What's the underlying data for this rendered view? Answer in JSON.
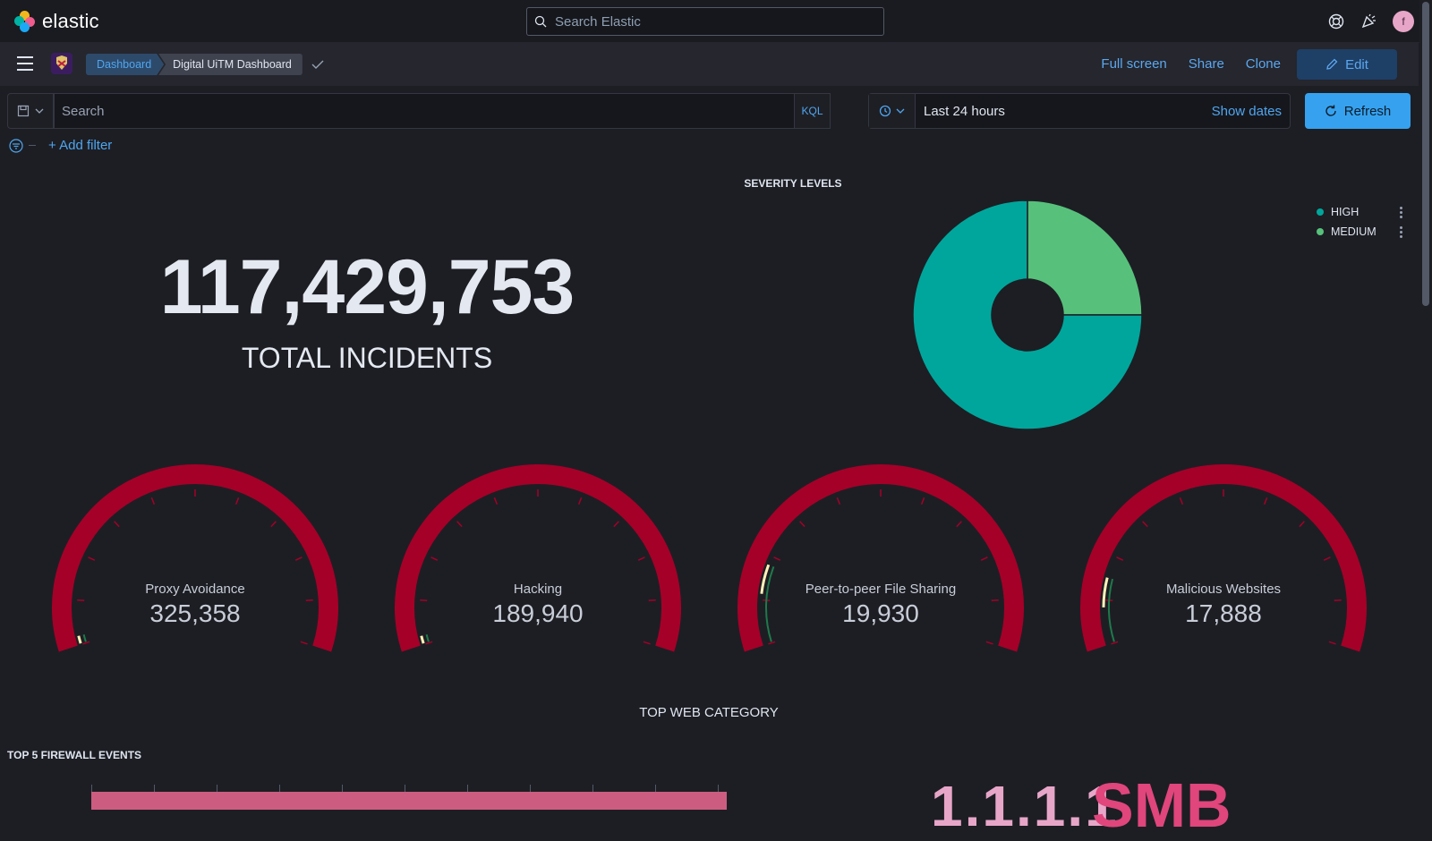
{
  "app": {
    "brand": "elastic",
    "search_placeholder": "Search Elastic",
    "user_initial": "f"
  },
  "nav": {
    "breadcrumbs": [
      "Dashboard",
      "Digital UiTM Dashboard"
    ],
    "actions": {
      "fullscreen": "Full screen",
      "share": "Share",
      "clone": "Clone",
      "edit": "Edit"
    }
  },
  "query": {
    "placeholder": "Search",
    "language": "KQL",
    "time_range": "Last 24 hours",
    "show_dates": "Show dates",
    "refresh": "Refresh",
    "add_filter": "+ Add filter"
  },
  "colors": {
    "accent": "#36a2ef",
    "gauge": "#a50028",
    "high": "#00a69b",
    "medium": "#57c17b",
    "pink": "#cc5d80"
  },
  "metric": {
    "value": "117,429,753",
    "label": "TOTAL INCIDENTS"
  },
  "severity": {
    "title": "SEVERITY LEVELS",
    "legend": [
      {
        "label": "HIGH",
        "color": "#00a69b"
      },
      {
        "label": "MEDIUM",
        "color": "#57c17b"
      }
    ]
  },
  "chart_data": {
    "type": "pie",
    "title": "SEVERITY LEVELS",
    "categories": [
      "HIGH",
      "MEDIUM"
    ],
    "values": [
      75,
      25
    ],
    "donut": true,
    "legend": "top-right"
  },
  "gauges": [
    {
      "label": "Proxy Avoidance",
      "value": "325,358",
      "level": 0.02
    },
    {
      "label": "Hacking",
      "value": "189,940",
      "level": 0.02
    },
    {
      "label": "Peer-to-peer File Sharing",
      "value": "19,930",
      "level": 0.18
    },
    {
      "label": "Malicious Websites",
      "value": "17,888",
      "level": 0.15
    }
  ],
  "sections": {
    "web_category": "TOP WEB CATEGORY",
    "firewall": "TOP 5 FIREWALL EVENTS"
  },
  "word_cloud": {
    "word1": "1.1.1.1",
    "word2": "SMB"
  }
}
